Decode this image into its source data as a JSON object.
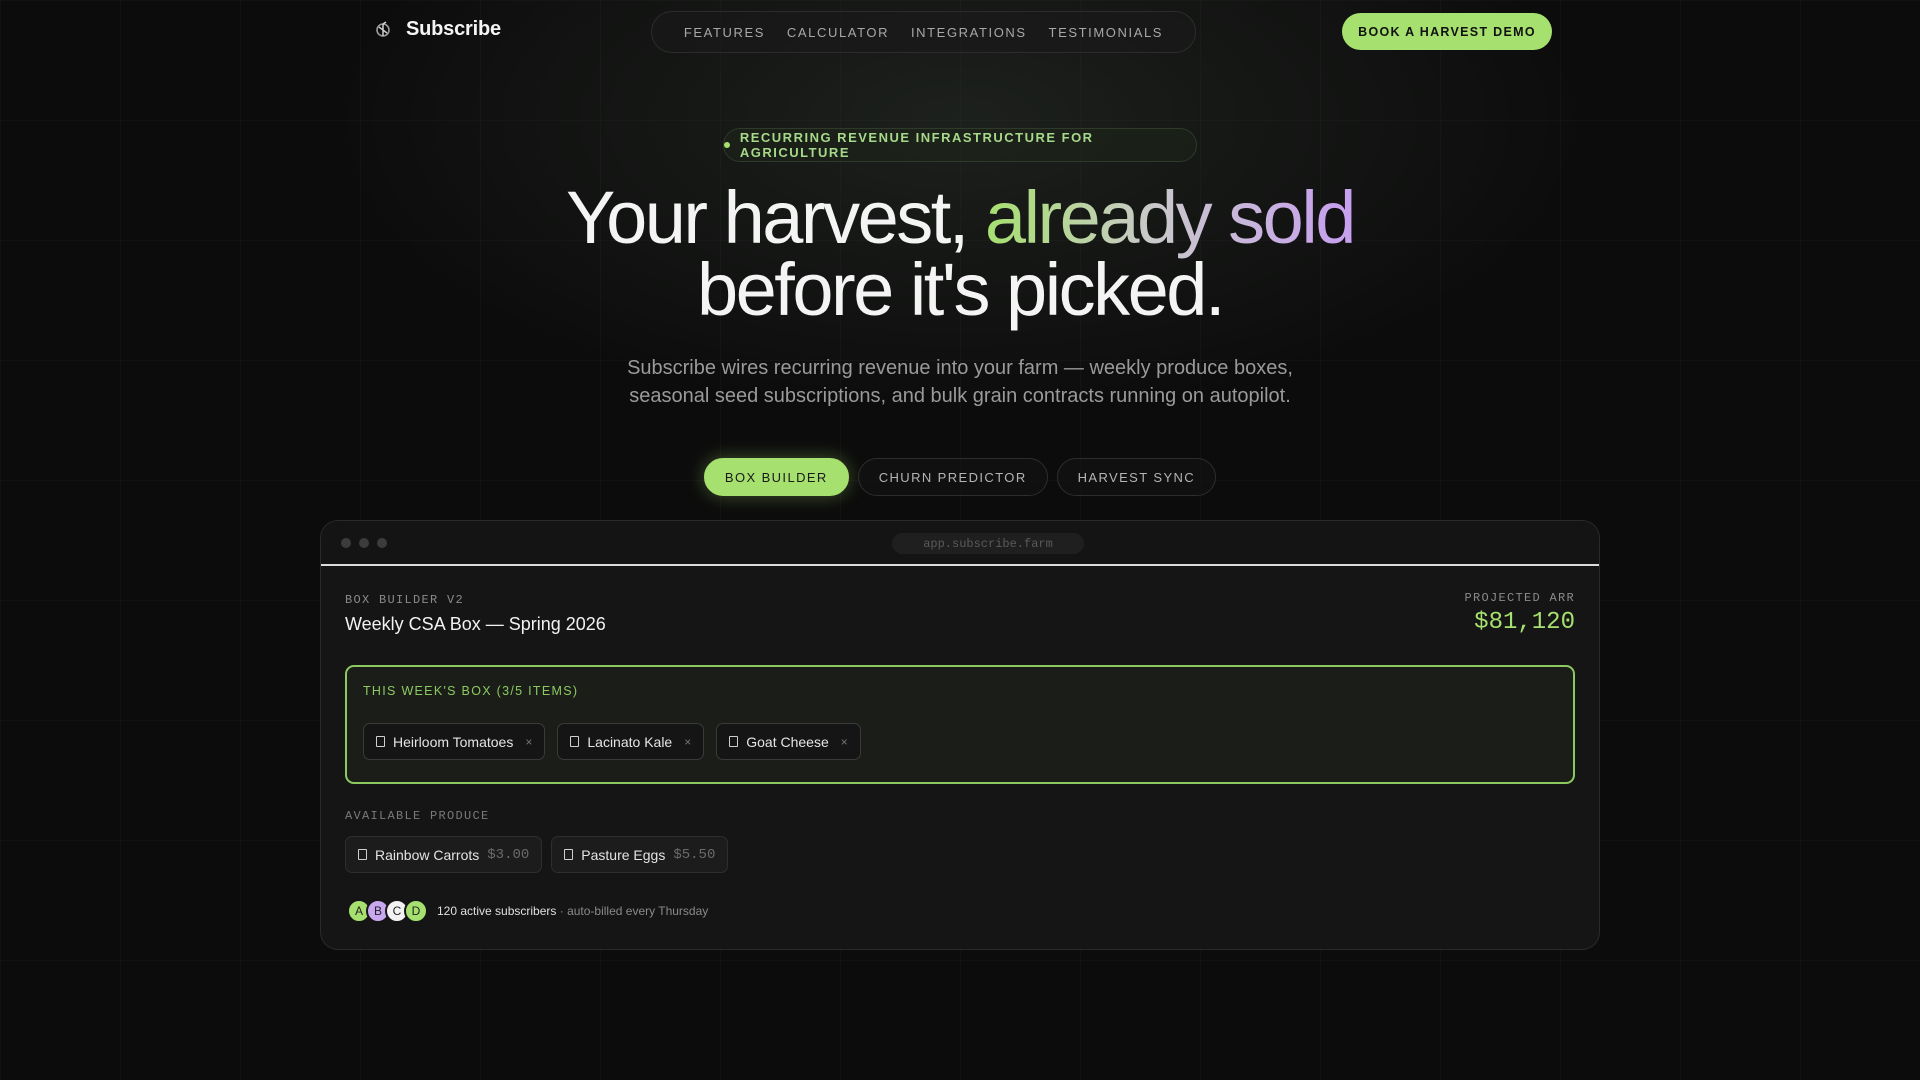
{
  "brand": {
    "name": "Subscribe"
  },
  "nav": {
    "links": [
      "FEATURES",
      "CALCULATOR",
      "INTEGRATIONS",
      "TESTIMONIALS"
    ],
    "cta": "BOOK A HARVEST DEMO"
  },
  "hero": {
    "badge": "RECURRING REVENUE INFRASTRUCTURE FOR AGRICULTURE",
    "title_part1": "Your harvest, ",
    "title_accent": "already sold",
    "title_part2": "before it's picked.",
    "subtitle_line1": "Subscribe wires recurring revenue into your farm — weekly produce boxes,",
    "subtitle_line2": "seasonal seed subscriptions, and bulk grain contracts running on autopilot."
  },
  "tabs": [
    {
      "label": "BOX BUILDER",
      "active": true
    },
    {
      "label": "CHURN PREDICTOR",
      "active": false
    },
    {
      "label": "HARVEST SYNC",
      "active": false
    }
  ],
  "app": {
    "url": "app.subscribe.farm",
    "section_label": "BOX BUILDER V2",
    "box_title": "Weekly CSA Box — Spring 2026",
    "arr_label": "PROJECTED ARR",
    "arr_value": "$81,120",
    "week_label": "THIS WEEK'S BOX (3/5 ITEMS)",
    "week_items": [
      "Heirloom Tomatoes",
      "Lacinato Kale",
      "Goat Cheese"
    ],
    "available_label": "AVAILABLE PRODUCE",
    "available_items": [
      {
        "name": "Rainbow Carrots",
        "price": "$3.00"
      },
      {
        "name": "Pasture Eggs",
        "price": "$5.50"
      }
    ],
    "avatars": [
      {
        "initial": "A",
        "color": "#a6e06e"
      },
      {
        "initial": "B",
        "color": "#c9a8f0"
      },
      {
        "initial": "C",
        "color": "#f2f2f2"
      },
      {
        "initial": "D",
        "color": "#a6e06e"
      }
    ],
    "subscribers": "120 active subscribers",
    "subscribers_note": "auto-billed every Thursday"
  },
  "colors": {
    "accent": "#a6e06e",
    "accent_purple": "#c79ef0",
    "background": "#0c0c0c"
  }
}
